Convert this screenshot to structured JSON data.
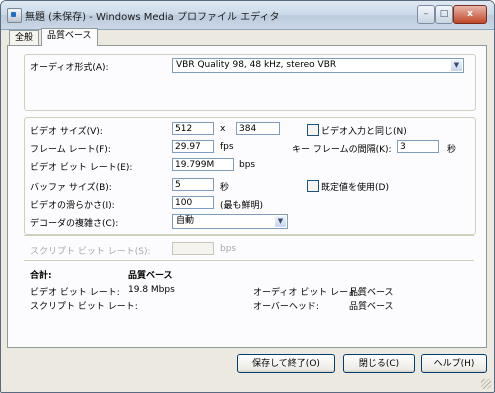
{
  "window": {
    "title": "無題 (未保存) - Windows Media プロファイル エディタ",
    "minimize_glyph": "–",
    "maximize_glyph": "□",
    "close_glyph": "x"
  },
  "tabs": [
    {
      "label": "全般"
    },
    {
      "label": "品質ベース"
    }
  ],
  "audio": {
    "format_label": "オーディオ形式(A):",
    "format_value": "VBR Quality 98, 48 kHz, stereo VBR"
  },
  "video": {
    "size_label": "ビデオ サイズ(V):",
    "width": "512",
    "by": "x",
    "height": "384",
    "same_as_input_label": "ビデオ入力と同じ(N)",
    "frame_rate_label": "フレーム レート(F):",
    "frame_rate": "29.97",
    "fps_unit": "fps",
    "keyframe_label": "キー フレームの間隔(K):",
    "keyframe": "3",
    "sec_unit": "秒",
    "bitrate_label": "ビデオ ビット レート(E):",
    "bitrate": "19.799M",
    "bps_unit": "bps",
    "buffer_label": "バッファ サイズ(B):",
    "buffer": "5",
    "buffer_unit": "秒",
    "use_default_label": "既定値を使用(D)",
    "smoothness_label": "ビデオの滑らかさ(I):",
    "smoothness": "100",
    "smoothness_note": "(最も鮮明)",
    "decoder_label": "デコーダの複雑さ(C):",
    "decoder_value": "自動"
  },
  "script": {
    "bitrate_label": "スクリプト ビット レート(S):",
    "bitrate": "",
    "bps_unit": "bps"
  },
  "summary": {
    "total_label": "合計:",
    "total_value": "品質ベース",
    "video_bitrate_label": "ビデオ ビット レート:",
    "video_bitrate_value": "19.8 Mbps",
    "script_bitrate_label": "スクリプト ビット レート:",
    "audio_bitrate_label": "オーディオ ビット レート:",
    "audio_bitrate_value": "品質ベース",
    "overhead_label": "オーバーヘッド:",
    "overhead_value": "品質ベース"
  },
  "buttons": {
    "save_close": "保存して終了(O)",
    "close": "閉じる(C)",
    "help": "ヘルプ(H)"
  }
}
